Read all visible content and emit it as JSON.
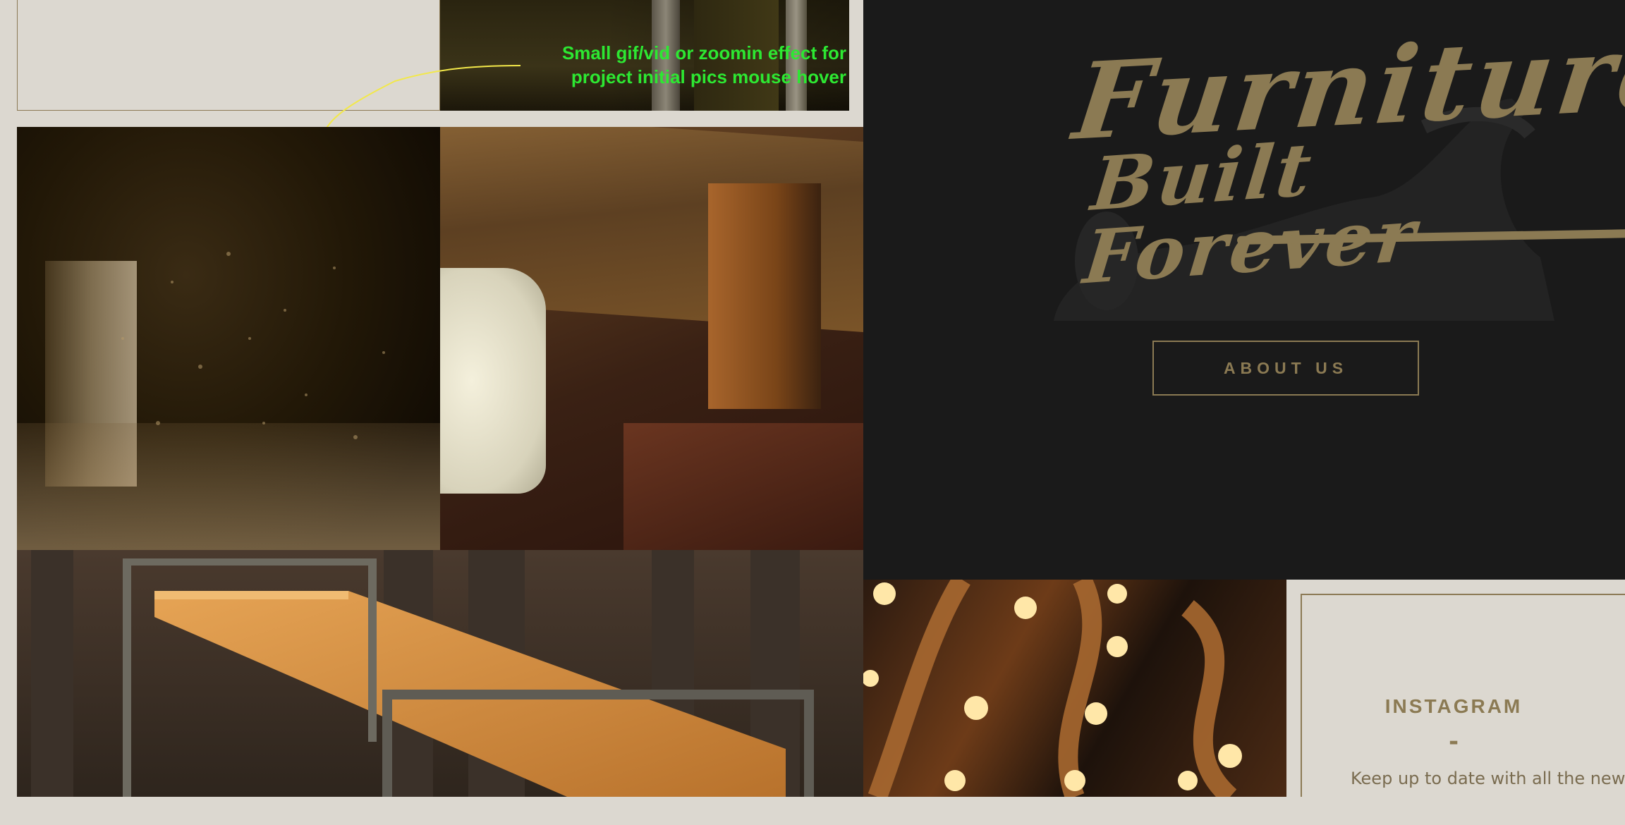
{
  "annotation": {
    "note_line1": "Small gif/vid or zoomin effect for",
    "note_line2": "project initial  pics mouse hover",
    "note_color": "#2de832",
    "arrow_color": "#f2e84a"
  },
  "hero": {
    "title_line1": "Furniture",
    "title_line2": "Built Forever",
    "about_button": "ABOUT US",
    "accent_color": "#8b7a53",
    "background": "#1a1a1a"
  },
  "instagram": {
    "title": "INSTAGRAM",
    "divider": "-",
    "body": "Keep up to date with all the newest f"
  },
  "images": [
    {
      "name": "sawdust-photo"
    },
    {
      "name": "nightstand-photo"
    },
    {
      "name": "bench-photo"
    },
    {
      "name": "marquee-bulbs-photo"
    }
  ]
}
